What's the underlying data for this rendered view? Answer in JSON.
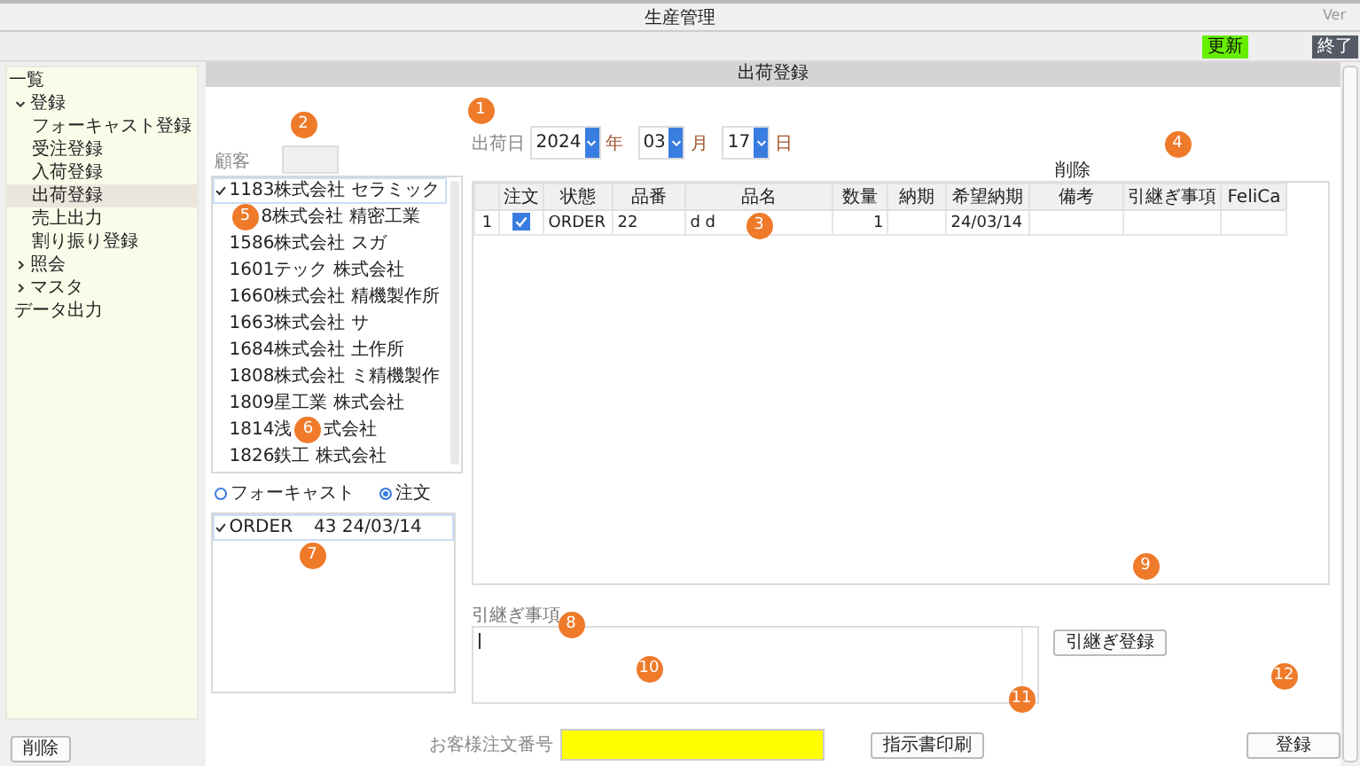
{
  "window": {
    "title": "生産管理",
    "version": "Ver"
  },
  "toolbar": {
    "buttons": [
      {
        "label": "更新",
        "kind": "refresh"
      },
      {
        "label": "終了",
        "kind": "exit"
      }
    ]
  },
  "sidebar": {
    "heading": "一覧",
    "items": [
      {
        "label": "登録",
        "expanded": true,
        "selected": false,
        "children": [
          {
            "label": "フォーキャスト登録",
            "selected": false
          },
          {
            "label": "受注登録",
            "selected": false
          },
          {
            "label": "入荷登録",
            "selected": false
          },
          {
            "label": "出荷登録",
            "selected": true
          },
          {
            "label": "売上出力",
            "selected": false
          },
          {
            "label": "割り振り登録",
            "selected": false
          }
        ]
      },
      {
        "label": "照会",
        "expanded": false,
        "selected": false
      },
      {
        "label": "マスタ",
        "expanded": false,
        "selected": false
      },
      {
        "label": "データ出力",
        "selected": false
      }
    ],
    "delete_button": "削除"
  },
  "panel": {
    "title": "出荷登録",
    "customer_label": "顧客",
    "customers": [
      {
        "parts": [
          "1183株式会社 セラミック"
        ],
        "selected": true
      },
      {
        "parts": [
          "8株式会社 精密工業"
        ],
        "start_hidden": true,
        "selected": false
      },
      {
        "parts": [
          "1586株式会社 スガ"
        ],
        "selected": false
      },
      {
        "parts": [
          "1601テック 株式会社"
        ],
        "selected": false
      },
      {
        "parts": [
          "1660株式会社 精機製作所"
        ],
        "selected": false
      },
      {
        "parts": [
          "1663株式会社 サ"
        ],
        "selected": false
      },
      {
        "parts": [
          "1684株式会社 土作所"
        ],
        "selected": false
      },
      {
        "parts": [
          "1808株式会社 ミ精機製作"
        ],
        "selected": false
      },
      {
        "parts": [
          "1809星工業 株式会社"
        ],
        "selected": false
      },
      {
        "parts": [
          "1814浅",
          "式会社"
        ],
        "selected": false
      },
      {
        "parts": [
          "1826鉄工 株式会社"
        ],
        "selected": false
      }
    ],
    "order_types": [
      {
        "label": "フォーキャスト",
        "selected": false
      },
      {
        "label": "注文",
        "selected": true
      }
    ],
    "orders": [
      {
        "parts": [
          "ORDER",
          "43 24/03/14"
        ],
        "selected": true
      }
    ],
    "ship_date": {
      "label": "出荷日",
      "year": "2024",
      "year_unit": "年",
      "month": "03",
      "month_unit": "月",
      "day": "17",
      "day_unit": "日"
    },
    "delete_label": "削除",
    "table": {
      "columns": [
        "",
        "注文",
        "状態",
        "品番",
        "品名",
        "数量",
        "納期",
        "希望納期",
        "備考",
        "引継ぎ事項",
        "FeliCa"
      ],
      "rows": [
        {
          "cells": [
            "1",
            "",
            "ORDER",
            "22",
            "d d",
            "1",
            "",
            "24/03/14",
            "",
            "",
            ""
          ],
          "checked": true
        }
      ]
    },
    "handover_label": "引継ぎ事項",
    "handover_button": "引継ぎ登録",
    "customer_order_label": "お客様注文番号",
    "print_button": "指示書印刷",
    "register_button": "登録"
  },
  "markers": [
    {
      "label": "1"
    },
    {
      "label": "2"
    },
    {
      "label": "3"
    },
    {
      "label": "4"
    },
    {
      "label": "5"
    },
    {
      "label": "6"
    },
    {
      "label": "7"
    },
    {
      "label": "8"
    },
    {
      "label": "9"
    },
    {
      "label": "10"
    },
    {
      "label": "11"
    },
    {
      "label": "12"
    }
  ]
}
